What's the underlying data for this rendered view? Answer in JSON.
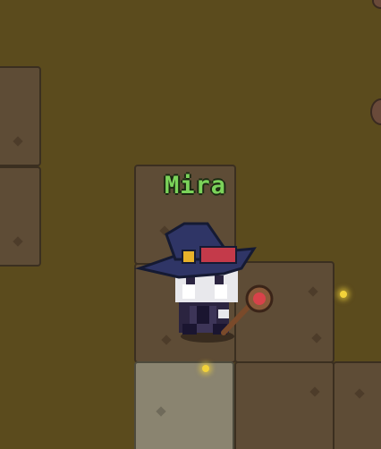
{
  "player": {
    "name": "Mira"
  },
  "colors": {
    "ground": "#5b4b1d",
    "floor_tile": "#5e4c36",
    "floor_tile_light": "#8a8470",
    "name_tag": "#7bd35a",
    "spark": "#f2d23a"
  },
  "icons": [
    "wizard-character",
    "staff-icon",
    "spark-icon"
  ]
}
